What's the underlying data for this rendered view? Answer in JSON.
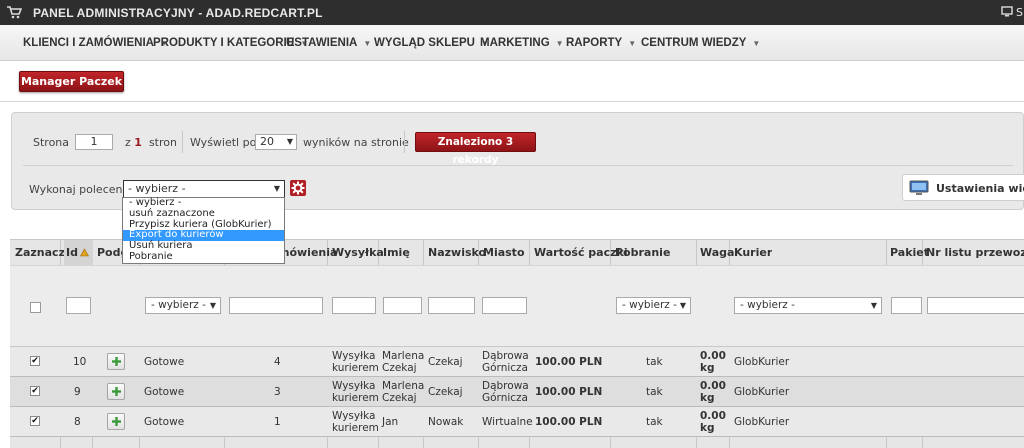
{
  "topbar": {
    "title": "PANEL ADMINISTRACYJNY - ADAD.REDCART.PL",
    "right_text": "S"
  },
  "menu": {
    "items": [
      "KLIENCI I ZAMÓWIENIA",
      "PRODUKTY I KATEGORIE",
      "USTAWIENIA",
      "WYGLĄD SKLEPU",
      "MARKETING",
      "RAPORTY",
      "CENTRUM WIEDZY"
    ]
  },
  "manager_button": "Manager Paczek",
  "pager": {
    "page_label": "Strona",
    "page_value": "1",
    "of_label": "z",
    "total_pages": "1",
    "pages_label": "stron",
    "show_label": "Wyświetl po",
    "per_page": "20",
    "per_page_suffix": "wyników na stronie",
    "found_label": "Znaleziono",
    "found_count": "3",
    "found_suffix": "rekordy"
  },
  "command": {
    "label": "Wykonaj polecenie:",
    "selected": "- wybierz -",
    "options": [
      "- wybierz -",
      "usuń zaznaczone",
      "Przypisz kuriera (GlobKurier)",
      "Export do kurierów",
      "Usuń kuriera",
      "Pobranie"
    ],
    "highlighted_index": 3
  },
  "settings_label": "Ustawienia widok",
  "table": {
    "headers": {
      "zaznacz": "Zaznacz",
      "id": "Id",
      "podgl": "Podg",
      "zamowienia": "mówienia",
      "wysylka": "Wysyłka",
      "imie": "Imię",
      "nazwisko": "Nazwisko",
      "miasto": "Miasto",
      "wartosc": "Wartość paczki",
      "pobranie": "Pobranie",
      "waga": "Waga",
      "kurier": "Kurier",
      "pakiet": "Pakiet",
      "nr_listu": "Nr listu przewozow"
    },
    "filter_placeholder": "- wybierz -",
    "rows": [
      {
        "id": "10",
        "status": "Gotowe",
        "zamowienia": "4",
        "wysylka_1": "Wysyłka",
        "wysylka_2": "kurierem",
        "imie_1": "Marlena",
        "imie_2": "Czekaj",
        "nazwisko": "Czekaj",
        "miasto_1": "Dąbrowa",
        "miasto_2": "Górnicza",
        "wartosc": "100.00 PLN",
        "pobranie": "tak",
        "waga_1": "0.00",
        "waga_2": "kg",
        "kurier": "GlobKurier"
      },
      {
        "id": "9",
        "status": "Gotowe",
        "zamowienia": "3",
        "wysylka_1": "Wysyłka",
        "wysylka_2": "kurierem",
        "imie_1": "Marlena",
        "imie_2": "Czekaj",
        "nazwisko": "Czekaj",
        "miasto_1": "Dąbrowa",
        "miasto_2": "Górnicza",
        "wartosc": "100.00 PLN",
        "pobranie": "tak",
        "waga_1": "0.00",
        "waga_2": "kg",
        "kurier": "GlobKurier"
      },
      {
        "id": "8",
        "status": "Gotowe",
        "zamowienia": "1",
        "wysylka_1": "Wysyłka",
        "wysylka_2": "kurierem",
        "imie_1": "Jan",
        "imie_2": "",
        "nazwisko": "Nowak",
        "miasto_1": "Wirtualne",
        "miasto_2": "",
        "wartosc": "100.00 PLN",
        "pobranie": "tak",
        "waga_1": "0.00",
        "waga_2": "kg",
        "kurier": "GlobKurier"
      }
    ]
  },
  "colors": {
    "accent_red": "#b11f23",
    "topbar": "#2e2e2e",
    "highlight": "#3399ff"
  }
}
